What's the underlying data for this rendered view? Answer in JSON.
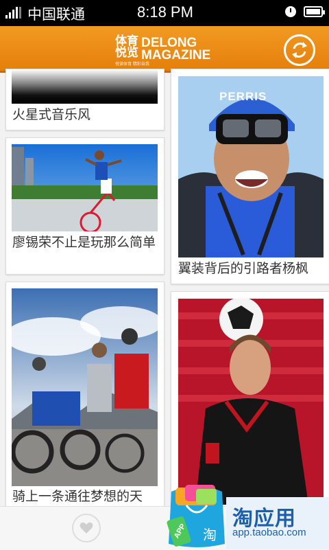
{
  "status_bar": {
    "carrier": "中国联通",
    "time": "8:18 PM"
  },
  "header": {
    "logo_cn": "体育\n悦览",
    "logo_en_line1": "DELONG",
    "logo_en_line2": "MAGAZINE",
    "logo_tagline": "悦读体育 精彩自我",
    "refresh_icon": "refresh-icon"
  },
  "feed": {
    "left": [
      {
        "title": "火星式音乐风"
      },
      {
        "title": "廖锡荣不止是玩那么简单"
      },
      {
        "title": "骑上一条通往梦想的天"
      }
    ],
    "right": [
      {
        "title": "翼装背后的引路者杨枫",
        "helmet_text": "PERRIS"
      },
      {
        "title": ""
      }
    ]
  },
  "bottom_bar": {
    "favorite_icon": "heart-icon"
  },
  "ad": {
    "title": "淘应用",
    "url": "app.taobao.com",
    "bag_label": "APP",
    "bag_char": "淘"
  },
  "colors": {
    "header": "#f29a22",
    "status_bar": "#000000",
    "ad_blue": "#1b5fae"
  }
}
